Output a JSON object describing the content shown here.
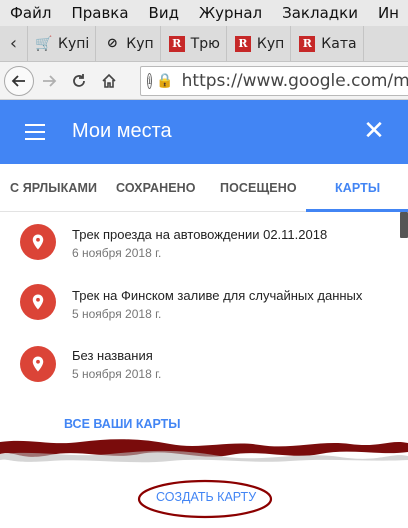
{
  "menubar": [
    "Файл",
    "Правка",
    "Вид",
    "Журнал",
    "Закладки",
    "Ин"
  ],
  "tabs": [
    {
      "icon": "shopping-cart-icon",
      "label": "Купі"
    },
    {
      "icon": "circle-logo-icon",
      "label": "Куп"
    },
    {
      "icon": "r-logo-icon",
      "label": "Трю"
    },
    {
      "icon": "r-logo-icon",
      "label": "Куп"
    },
    {
      "icon": "r-logo-icon",
      "label": "Ката"
    }
  ],
  "address": {
    "url": "https://www.google.com/map"
  },
  "header": {
    "title": "Мои места"
  },
  "nav_tabs": [
    {
      "label": "С ЯРЛЫКАМИ",
      "active": false
    },
    {
      "label": "СОХРАНЕНО",
      "active": false
    },
    {
      "label": "ПОСЕЩЕНО",
      "active": false
    },
    {
      "label": "КАРТЫ",
      "active": true
    }
  ],
  "maps": [
    {
      "name": "Трек проезда на автовождении 02.11.2018",
      "date": "6 ноября 2018 г."
    },
    {
      "name": "Трек на Финском заливе для случайных данных",
      "date": "5 ноября 2018 г."
    },
    {
      "name": "Без названия",
      "date": "5 ноября 2018 г."
    }
  ],
  "links": {
    "all_maps": "ВСЕ ВАШИ КАРТЫ",
    "create_map": "СОЗДАТЬ КАРТУ"
  },
  "colors": {
    "accent": "#4285f4",
    "pin": "#db4437",
    "annotation": "#8b0000"
  }
}
